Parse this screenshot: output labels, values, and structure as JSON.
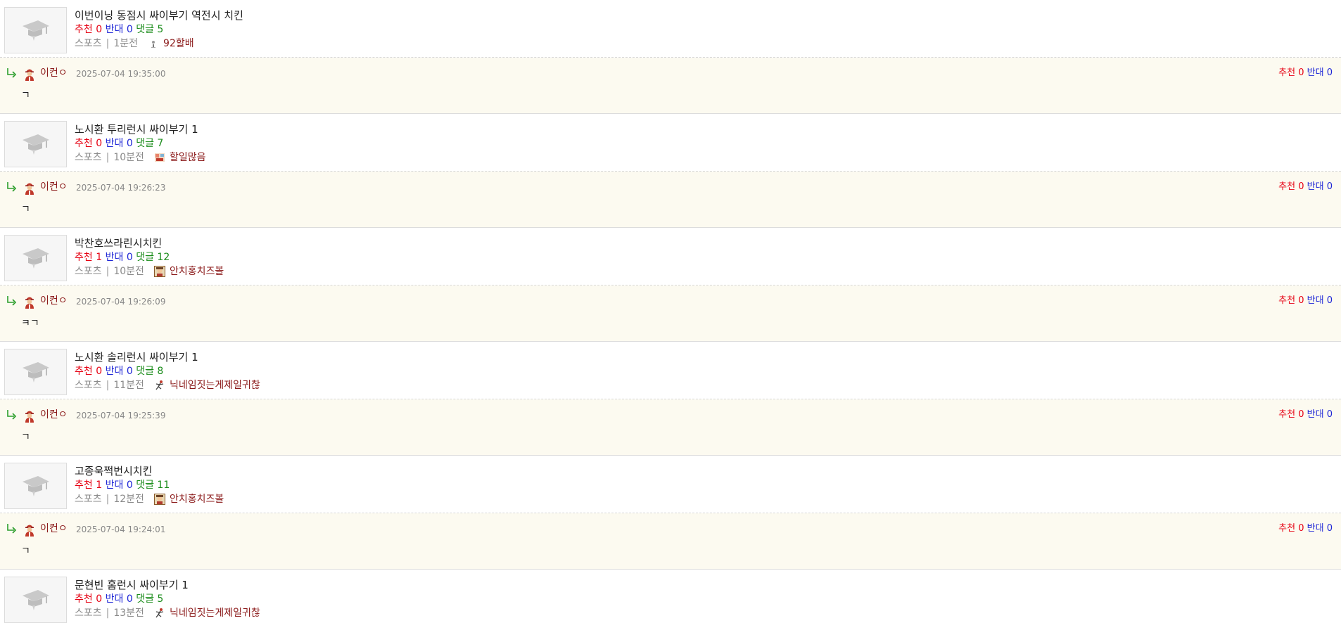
{
  "labels": {
    "recommend": "추천",
    "oppose": "반대",
    "comments": "댓글",
    "separator": "|"
  },
  "colors": {
    "recommend": "#e60012",
    "oppose": "#1e26d6",
    "comments": "#1a8c1a",
    "author": "#8b1a1a",
    "comment_background": "#fcfaf0"
  },
  "entries": [
    {
      "post": {
        "title": "이번이닝 동점시 싸이부기 역전시 치킨",
        "recommend": "0",
        "oppose": "0",
        "comments": "5",
        "category": "스포츠",
        "time": "1분전",
        "author": "92할배",
        "author_icon": "small-figure-icon",
        "thumbnail_icon": "graduation-cap-icon"
      },
      "comment": {
        "author": "이컨ㅇ",
        "avatar_icon": "baseball-player-avatar-icon",
        "date": "2025-07-04 19:35:00",
        "recommend": "0",
        "oppose": "0",
        "body": "ㄱ"
      }
    },
    {
      "post": {
        "title": "노시환 투리런시 싸이부기 1",
        "recommend": "0",
        "oppose": "0",
        "comments": "7",
        "category": "스포츠",
        "time": "10분전",
        "author": "할일많음",
        "author_icon": "pixel-character-icon",
        "thumbnail_icon": "graduation-cap-icon"
      },
      "comment": {
        "author": "이컨ㅇ",
        "avatar_icon": "baseball-player-avatar-icon",
        "date": "2025-07-04 19:26:23",
        "recommend": "0",
        "oppose": "0",
        "body": "ㄱ"
      }
    },
    {
      "post": {
        "title": "박찬호쓰라린시치킨",
        "recommend": "1",
        "oppose": "0",
        "comments": "12",
        "category": "스포츠",
        "time": "10분전",
        "author": "안치홍치즈볼",
        "author_icon": "portrait-frame-icon",
        "thumbnail_icon": "graduation-cap-icon"
      },
      "comment": {
        "author": "이컨ㅇ",
        "avatar_icon": "baseball-player-avatar-icon",
        "date": "2025-07-04 19:26:09",
        "recommend": "0",
        "oppose": "0",
        "body": "ㅋㄱ"
      }
    },
    {
      "post": {
        "title": "노시환 솔리런시 싸이부기 1",
        "recommend": "0",
        "oppose": "0",
        "comments": "8",
        "category": "스포츠",
        "time": "11분전",
        "author": "닉네임짓는게제일귀찮",
        "author_icon": "running-figure-icon",
        "thumbnail_icon": "graduation-cap-icon"
      },
      "comment": {
        "author": "이컨ㅇ",
        "avatar_icon": "baseball-player-avatar-icon",
        "date": "2025-07-04 19:25:39",
        "recommend": "0",
        "oppose": "0",
        "body": "ㄱ"
      }
    },
    {
      "post": {
        "title": "고종욱쩍번시치킨",
        "recommend": "1",
        "oppose": "0",
        "comments": "11",
        "category": "스포츠",
        "time": "12분전",
        "author": "안치홍치즈볼",
        "author_icon": "portrait-frame-icon",
        "thumbnail_icon": "graduation-cap-icon"
      },
      "comment": {
        "author": "이컨ㅇ",
        "avatar_icon": "baseball-player-avatar-icon",
        "date": "2025-07-04 19:24:01",
        "recommend": "0",
        "oppose": "0",
        "body": "ㄱ"
      }
    },
    {
      "post": {
        "title": "문현빈 홈런시 싸이부기 1",
        "recommend": "0",
        "oppose": "0",
        "comments": "5",
        "category": "스포츠",
        "time": "13분전",
        "author": "닉네임짓는게제일귀찮",
        "author_icon": "running-figure-icon",
        "thumbnail_icon": "graduation-cap-icon"
      }
    }
  ]
}
